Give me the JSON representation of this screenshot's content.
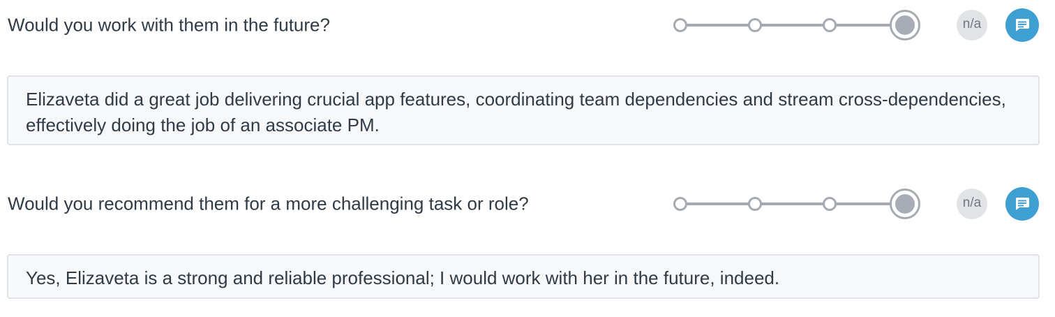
{
  "questions": [
    {
      "label": "Would you work with them in the future?",
      "scale": {
        "steps": 4,
        "selected": 4
      },
      "na_label": "n/a",
      "comment_icon": "comment-icon",
      "answer": "Elizaveta did a great job delivering crucial app features, coordinating team dependencies and stream cross-dependencies, effectively doing the job of an associate PM."
    },
    {
      "label": "Would you recommend them for a more challenging task or role?",
      "scale": {
        "steps": 4,
        "selected": 4
      },
      "na_label": "n/a",
      "comment_icon": "comment-icon",
      "answer": "Yes, Elizaveta is a strong and reliable professional; I would work with her in the future, indeed."
    }
  ],
  "colors": {
    "accent": "#3d9fd2",
    "scale": "#a5aab4",
    "answer_background": "#f7f8fa",
    "answer_border": "#dfe2e7",
    "text": "#2f3b47"
  }
}
